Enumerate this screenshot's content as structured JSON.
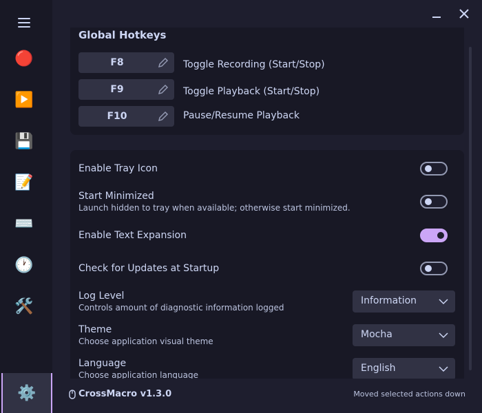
{
  "sidebar": {
    "menu_icon": "hamburger-icon",
    "items": [
      {
        "name": "record",
        "icon": "🔴"
      },
      {
        "name": "playback",
        "icon": "▶️"
      },
      {
        "name": "save",
        "icon": "💾"
      },
      {
        "name": "editor",
        "icon": "📝"
      },
      {
        "name": "hotkeys",
        "icon": "⌨️"
      },
      {
        "name": "schedule",
        "icon": "🕐"
      },
      {
        "name": "tools",
        "icon": "🛠️"
      }
    ],
    "active": {
      "name": "settings",
      "icon": "⚙️"
    }
  },
  "window": {
    "minimize_icon": "minimize-icon",
    "close_icon": "close-icon"
  },
  "hotkeys": {
    "title": "Global Hotkeys",
    "items": [
      {
        "key": "F8",
        "description": "Toggle Recording (Start/Stop)"
      },
      {
        "key": "F9",
        "description": "Toggle Playback (Start/Stop)"
      },
      {
        "key": "F10",
        "description": "Pause/Resume Playback"
      }
    ]
  },
  "settings": {
    "tray": {
      "label": "Enable Tray Icon",
      "enabled": false
    },
    "minimized": {
      "label": "Start Minimized",
      "description": "Launch hidden to tray when available; otherwise start minimized.",
      "enabled": false
    },
    "expansion": {
      "label": "Enable Text Expansion",
      "enabled": true
    },
    "updates": {
      "label": "Check for Updates at Startup",
      "enabled": false
    },
    "log_level": {
      "label": "Log Level",
      "description": "Controls amount of diagnostic information logged",
      "value": "Information"
    },
    "theme": {
      "label": "Theme",
      "description": "Choose application visual theme",
      "value": "Mocha"
    },
    "language": {
      "label": "Language",
      "description": "Choose application language",
      "value": "English"
    }
  },
  "footer": {
    "app_icon": "mouse-icon",
    "app_name": "CrossMacro v1.3.0",
    "status": "Moved selected actions down"
  },
  "colors": {
    "background": "#1e1e2e",
    "sidebar": "#181825",
    "card": "#181825",
    "control": "#313244",
    "accent": "#cba6f7",
    "text": "#cdd6f4"
  }
}
